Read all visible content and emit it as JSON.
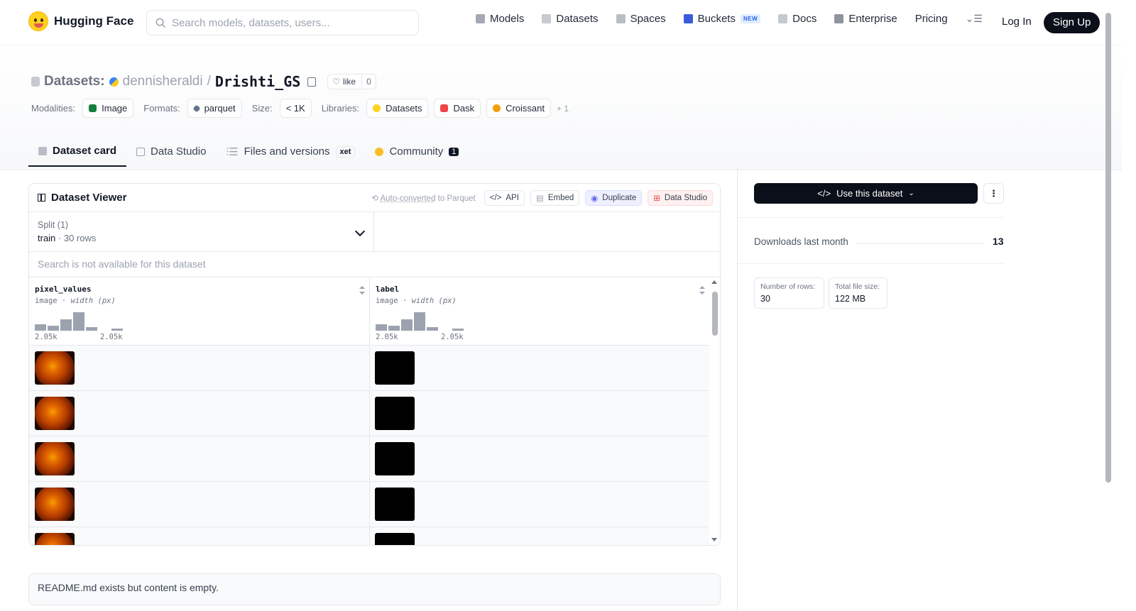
{
  "header": {
    "brand": "Hugging Face",
    "search_placeholder": "Search models, datasets, users...",
    "nav": [
      "Models",
      "Datasets",
      "Spaces",
      "Buckets",
      "Docs",
      "Enterprise",
      "Pricing"
    ],
    "new_badge": "NEW",
    "login": "Log In",
    "signup": "Sign Up"
  },
  "dataset": {
    "prefix": "Datasets:",
    "owner": "dennisheraldi",
    "separator": "/",
    "name": "Drishti_GS",
    "like_label": "like",
    "like_count": "0"
  },
  "meta": {
    "modalities_label": "Modalities:",
    "modalities": "Image",
    "formats_label": "Formats:",
    "formats": "parquet",
    "size_label": "Size:",
    "size": "< 1K",
    "libraries_label": "Libraries:",
    "libraries": [
      "Datasets",
      "Dask",
      "Croissant"
    ],
    "more": "+ 1"
  },
  "tabs": {
    "dataset_card": "Dataset card",
    "data_studio": "Data Studio",
    "files": "Files and versions",
    "xet": "xet",
    "community": "Community",
    "community_count": "1"
  },
  "viewer": {
    "title": "Dataset Viewer",
    "autoconv_link": "Auto-converted",
    "autoconv_rest": " to Parquet",
    "api": "API",
    "embed": "Embed",
    "duplicate": "Duplicate",
    "data_studio": "Data Studio",
    "split_label": "Split (1)",
    "split_name": "train",
    "split_rows": "30 rows",
    "search_na": "Search is not available for this dataset",
    "columns": [
      {
        "name": "pixel_values",
        "type": "image",
        "stat": "width (px)",
        "min": "2.05k",
        "max": "2.05k"
      },
      {
        "name": "label",
        "type": "image",
        "stat": "width (px)",
        "min": "2.05k",
        "max": "2.05k"
      }
    ],
    "histogram": [
      0.35,
      0.25,
      0.6,
      1.0,
      0.18,
      0,
      0.1
    ]
  },
  "readme": "README.md exists but content is empty.",
  "sidebar": {
    "use_button": "Use this dataset",
    "downloads_label": "Downloads last month",
    "downloads_value": "13",
    "rows_label": "Number of rows:",
    "rows_value": "30",
    "size_label": "Total file size:",
    "size_value": "122 MB"
  },
  "colors": {
    "primary_dark": "#0b0f19",
    "border": "#e5e7eb",
    "muted": "#6b7280"
  }
}
